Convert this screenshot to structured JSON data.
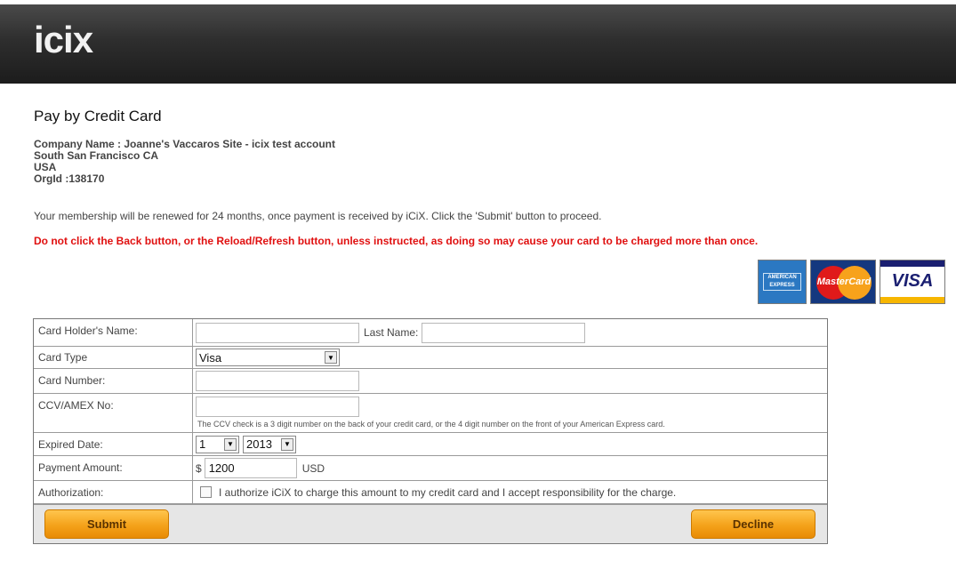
{
  "header": {
    "logo_text": "icix"
  },
  "page": {
    "title": "Pay by Credit Card",
    "company_lines": [
      "Company Name : Joanne's Vaccaros Site - icix test account",
      "South San Francisco CA",
      "USA",
      "OrgId :138170"
    ],
    "renewal_notice": "Your membership will be renewed for 24 months, once payment is received by iCiX. Click the 'Submit' button to proceed.",
    "warning": "Do not click the Back button, or the Reload/Refresh button, unless instructed, as doing so may cause your card to be charged more than once."
  },
  "card_logos": {
    "amex": "AMERICAN EXPRESS",
    "mastercard": "MasterCard",
    "visa": "VISA"
  },
  "form": {
    "card_holder_label": "Card Holder's Name:",
    "first_name_value": "",
    "last_name_label": "Last Name:",
    "last_name_value": "",
    "card_type_label": "Card Type",
    "card_type_value": "Visa",
    "card_number_label": "Card Number:",
    "card_number_value": "",
    "ccv_label": "CCV/AMEX No:",
    "ccv_value": "",
    "ccv_note": "The CCV check is a 3 digit number on the back of your credit card, or the 4 digit number on the front of your American Express card.",
    "expired_label": "Expired Date:",
    "exp_month": "1",
    "exp_year": "2013",
    "payment_label": "Payment Amount:",
    "currency_symbol": "$",
    "amount": "1200",
    "currency": "USD",
    "authorization_label": "Authorization:",
    "authorization_text": "I authorize iCiX to charge this amount to my credit card and I accept responsibility for the charge.",
    "authorized": false
  },
  "buttons": {
    "submit": "Submit",
    "decline": "Decline"
  },
  "colors": {
    "header": "#2e2e2e",
    "warning": "#e01010",
    "button": "#f4a21a"
  }
}
